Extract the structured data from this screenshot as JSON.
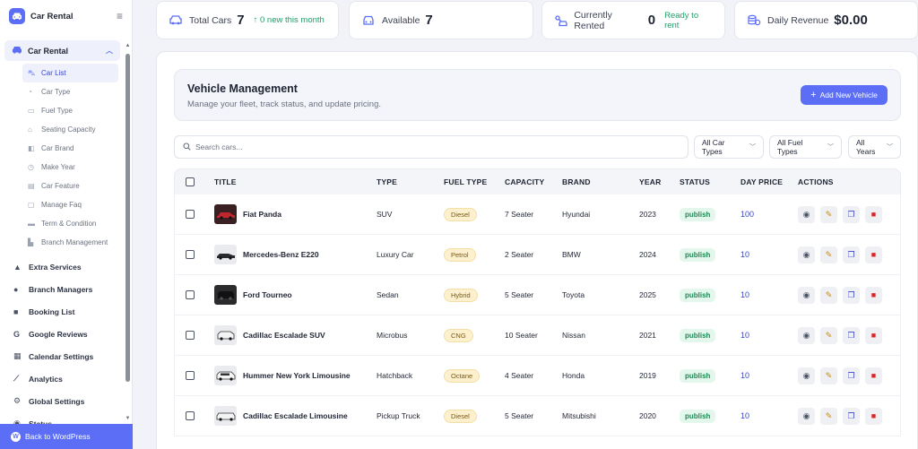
{
  "brand": {
    "name": "Car Rental",
    "icon": "car-logo-icon"
  },
  "sidebar": {
    "section": {
      "label": "Car Rental",
      "icon": "car-icon"
    },
    "sub_items": [
      {
        "label": "Car List",
        "icon": "car-list-icon",
        "active": true
      },
      {
        "label": "Car Type",
        "icon": "car-type-icon"
      },
      {
        "label": "Fuel Type",
        "icon": "fuel-type-icon"
      },
      {
        "label": "Seating Capacity",
        "icon": "seat-icon"
      },
      {
        "label": "Car Brand",
        "icon": "brand-icon"
      },
      {
        "label": "Make Year",
        "icon": "clock-icon"
      },
      {
        "label": "Car Feature",
        "icon": "feature-icon"
      },
      {
        "label": "Manage Faq",
        "icon": "faq-icon"
      },
      {
        "label": "Term & Condition",
        "icon": "terms-icon"
      },
      {
        "label": "Branch Management",
        "icon": "branch-icon"
      }
    ],
    "main_items": [
      {
        "label": "Extra Services",
        "icon": "extra-services-icon"
      },
      {
        "label": "Branch Managers",
        "icon": "user-icon"
      },
      {
        "label": "Booking List",
        "icon": "booking-icon"
      },
      {
        "label": "Google Reviews",
        "icon": "google-icon"
      },
      {
        "label": "Calendar Settings",
        "icon": "calendar-icon"
      },
      {
        "label": "Analytics",
        "icon": "analytics-icon"
      },
      {
        "label": "Global Settings",
        "icon": "gear-icon"
      },
      {
        "label": "Status",
        "icon": "status-icon"
      }
    ],
    "back_label": "Back to WordPress"
  },
  "stats": {
    "total": {
      "label": "Total Cars",
      "value": "7",
      "note": "↑ 0 new this month"
    },
    "available": {
      "label": "Available",
      "value": "7"
    },
    "rented": {
      "label": "Currently Rented",
      "value": "0",
      "note": "Ready to rent"
    },
    "revenue": {
      "label": "Daily Revenue",
      "value": "$0.00"
    }
  },
  "vehicle_management": {
    "title": "Vehicle Management",
    "subtitle": "Manage your fleet, track status, and update pricing.",
    "add_button": "Add New Vehicle"
  },
  "search": {
    "placeholder": "Search cars..."
  },
  "filters": {
    "car_types": "All Car Types",
    "fuel_types": "All Fuel Types",
    "years": "All Years"
  },
  "table": {
    "headers": {
      "title": "Title",
      "type": "Type",
      "fuel": "Fuel Type",
      "capacity": "Capacity",
      "brand": "Brand",
      "year": "Year",
      "status": "Status",
      "price": "Day Price",
      "actions": "Actions"
    },
    "rows": [
      {
        "title": "Fiat Panda",
        "type": "SUV",
        "fuel": "Diesel",
        "capacity": "7 Seater",
        "brand": "Hyundai",
        "year": "2023",
        "status": "publish",
        "price": "100"
      },
      {
        "title": "Mercedes-Benz E220",
        "type": "Luxury Car",
        "fuel": "Petrol",
        "capacity": "2 Seater",
        "brand": "BMW",
        "year": "2024",
        "status": "publish",
        "price": "10"
      },
      {
        "title": "Ford Tourneo",
        "type": "Sedan",
        "fuel": "Hybrid",
        "capacity": "5 Seater",
        "brand": "Toyota",
        "year": "2025",
        "status": "publish",
        "price": "10"
      },
      {
        "title": "Cadillac Escalade SUV",
        "type": "Microbus",
        "fuel": "CNG",
        "capacity": "10 Seater",
        "brand": "Nissan",
        "year": "2021",
        "status": "publish",
        "price": "10"
      },
      {
        "title": "Hummer New York Limousine",
        "type": "Hatchback",
        "fuel": "Octane",
        "capacity": "4 Seater",
        "brand": "Honda",
        "year": "2019",
        "status": "publish",
        "price": "10"
      },
      {
        "title": "Cadillac Escalade Limousine",
        "type": "Pickup Truck",
        "fuel": "Diesel",
        "capacity": "5 Seater",
        "brand": "Mitsubishi",
        "year": "2020",
        "status": "publish",
        "price": "10"
      }
    ]
  },
  "colors": {
    "accent": "#5b6ef5",
    "success": "#22a06b",
    "danger": "#dc2626"
  }
}
